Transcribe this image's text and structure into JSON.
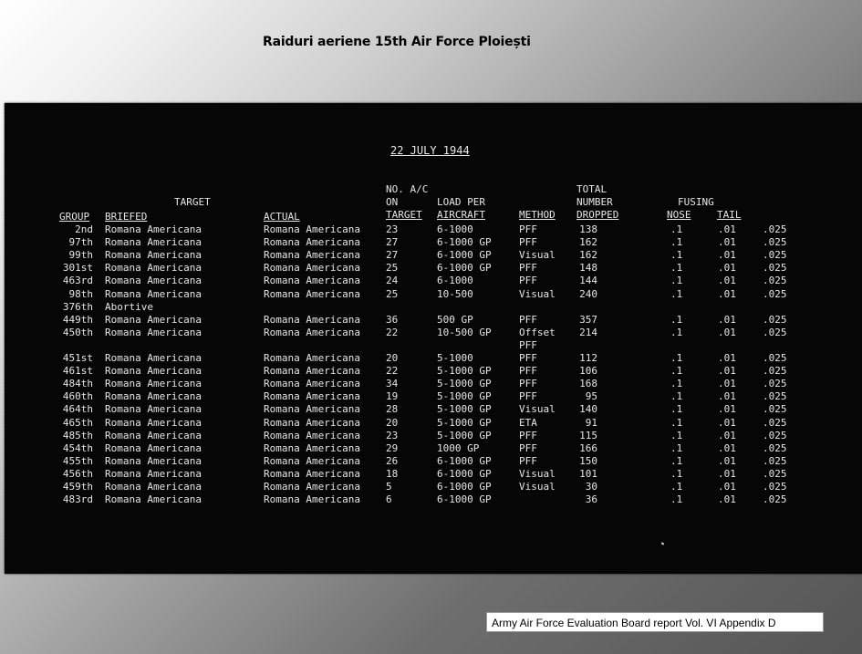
{
  "slide": {
    "title": "Raiduri aeriene 15th Air Force Ploiești",
    "source_note": "Army Air Force  Evaluation Board report Vol. VI Appendix  D"
  },
  "document": {
    "date": "22 JULY 1944",
    "headers": {
      "target": "TARGET",
      "group": "GROUP",
      "briefed": "BRIEFED",
      "actual": "ACTUAL",
      "no_ac_1": "NO. A/C",
      "no_ac_2": "ON",
      "no_ac_3": "TARGET",
      "load_1": "LOAD PER",
      "load_2": "AIRCRAFT",
      "method": "METHOD",
      "total_1": "TOTAL",
      "total_2": "NUMBER",
      "total_3": "DROPPED",
      "fusing": "FUSING",
      "nose": "NOSE",
      "tail": "TAIL"
    },
    "rows": [
      {
        "group": "2nd",
        "briefed": "Romana Americana",
        "actual": "Romana Americana",
        "ac": "23",
        "load": "6-1000",
        "method": "PFF",
        "dropped": "138",
        "nose": ".1",
        "tail": ".01",
        "extra": ".025"
      },
      {
        "group": "97th",
        "briefed": "Romana Americana",
        "actual": "Romana Americana",
        "ac": "27",
        "load": "6-1000 GP",
        "method": "PFF",
        "dropped": "162",
        "nose": ".1",
        "tail": ".01",
        "extra": ".025"
      },
      {
        "group": "99th",
        "briefed": "Romana Americana",
        "actual": "Romana Americana",
        "ac": "27",
        "load": "6-1000 GP",
        "method": "Visual",
        "dropped": "162",
        "nose": ".1",
        "tail": ".01",
        "extra": ".025"
      },
      {
        "group": "301st",
        "briefed": "Romana Americana",
        "actual": "Romana Americana",
        "ac": "25",
        "load": "6-1000 GP",
        "method": "PFF",
        "dropped": "148",
        "nose": ".1",
        "tail": ".01",
        "extra": ".025"
      },
      {
        "group": "463rd",
        "briefed": "Romana Americana",
        "actual": "Romana Americana",
        "ac": "24",
        "load": "6-1000",
        "method": "PFF",
        "dropped": "144",
        "nose": ".1",
        "tail": ".01",
        "extra": ".025"
      },
      {
        "group": "98th",
        "briefed": "Romana Americana",
        "actual": "Romana Americana",
        "ac": "25",
        "load": "10-500",
        "method": "Visual",
        "dropped": "240",
        "nose": ".1",
        "tail": ".01",
        "extra": ".025"
      },
      {
        "group": "376th",
        "briefed": "Abortive",
        "actual": "",
        "ac": "",
        "load": "",
        "method": "",
        "dropped": "",
        "nose": "",
        "tail": "",
        "extra": ""
      },
      {
        "group": "449th",
        "briefed": "Romana Americana",
        "actual": "Romana Americana",
        "ac": "36",
        "load": "500 GP",
        "method": "PFF",
        "dropped": "357",
        "nose": ".1",
        "tail": ".01",
        "extra": ".025"
      },
      {
        "group": "450th",
        "briefed": "Romana Americana",
        "actual": "Romana Americana",
        "ac": "22",
        "load": "10-500 GP",
        "method": "Offset",
        "dropped": "214",
        "nose": ".1",
        "tail": ".01",
        "extra": ".025"
      },
      {
        "group": "",
        "briefed": "",
        "actual": "",
        "ac": "",
        "load": "",
        "method": "PFF",
        "dropped": "",
        "nose": "",
        "tail": "",
        "extra": ""
      },
      {
        "group": "451st",
        "briefed": "Romana Americana",
        "actual": "Romana Americana",
        "ac": "20",
        "load": "5-1000",
        "method": "PFF",
        "dropped": "112",
        "nose": ".1",
        "tail": ".01",
        "extra": ".025"
      },
      {
        "group": "461st",
        "briefed": "Romana Americana",
        "actual": "Romana Americana",
        "ac": "22",
        "load": "5-1000 GP",
        "method": "PFF",
        "dropped": "106",
        "nose": ".1",
        "tail": ".01",
        "extra": ".025"
      },
      {
        "group": "484th",
        "briefed": "Romana Americana",
        "actual": "Romana Americana",
        "ac": "34",
        "load": "5-1000 GP",
        "method": "PFF",
        "dropped": "168",
        "nose": ".1",
        "tail": ".01",
        "extra": ".025"
      },
      {
        "group": "460th",
        "briefed": "Romana Americana",
        "actual": "Romana Americana",
        "ac": "19",
        "load": "5-1000 GP",
        "method": "PFF",
        "dropped": "95",
        "nose": ".1",
        "tail": ".01",
        "extra": ".025"
      },
      {
        "group": "464th",
        "briefed": "Romana Americana",
        "actual": "Romana Americana",
        "ac": "28",
        "load": "5-1000 GP",
        "method": "Visual",
        "dropped": "140",
        "nose": ".1",
        "tail": ".01",
        "extra": ".025"
      },
      {
        "group": "465th",
        "briefed": "Romana Americana",
        "actual": "Romana Americana",
        "ac": "20",
        "load": "5-1000 GP",
        "method": "ETA",
        "dropped": "91",
        "nose": ".1",
        "tail": ".01",
        "extra": ".025"
      },
      {
        "group": "485th",
        "briefed": "Romana Americana",
        "actual": "Romana Americana",
        "ac": "23",
        "load": "5-1000 GP",
        "method": "PFF",
        "dropped": "115",
        "nose": ".1",
        "tail": ".01",
        "extra": ".025"
      },
      {
        "group": "454th",
        "briefed": "Romana Americana",
        "actual": "Romana Americana",
        "ac": "29",
        "load": "1000 GP",
        "method": "PFF",
        "dropped": "166",
        "nose": ".1",
        "tail": ".01",
        "extra": ".025"
      },
      {
        "group": "455th",
        "briefed": "Romana Americana",
        "actual": "Romana Americana",
        "ac": "26",
        "load": "6-1000 GP",
        "method": "PFF",
        "dropped": "150",
        "nose": ".1",
        "tail": ".01",
        "extra": ".025"
      },
      {
        "group": "456th",
        "briefed": "Romana Americana",
        "actual": "Romana Americana",
        "ac": "18",
        "load": "6-1000 GP",
        "method": "Visual",
        "dropped": "101",
        "nose": ".1",
        "tail": ".01",
        "extra": ".025"
      },
      {
        "group": "459th",
        "briefed": "Romana Americana",
        "actual": "Romana Americana",
        "ac": "5",
        "load": "6-1000 GP",
        "method": "Visual",
        "dropped": "30",
        "nose": ".1",
        "tail": ".01",
        "extra": ".025"
      },
      {
        "group": "483rd",
        "briefed": "Romana Americana",
        "actual": "Romana Americana",
        "ac": "6",
        "load": "6-1000 GP",
        "method": "",
        "dropped": "36",
        "nose": ".1",
        "tail": ".01",
        "extra": ".025"
      }
    ]
  }
}
